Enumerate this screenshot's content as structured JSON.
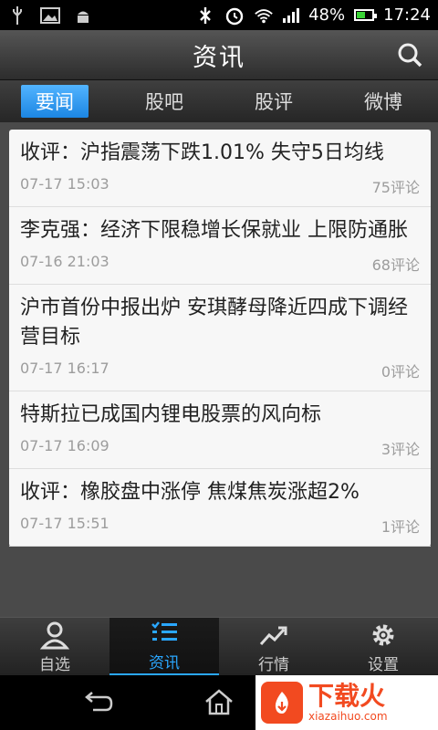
{
  "status": {
    "battery": "48%",
    "time": "17:24",
    "battery_level": 0.48,
    "left_icons": [
      "usb-icon",
      "image-icon",
      "android-icon"
    ],
    "right_icons": [
      "bluetooth-off-icon",
      "alarm-icon",
      "wifi-icon",
      "signal-icon",
      "battery-icon"
    ]
  },
  "header": {
    "title": "资讯",
    "search_icon": "search-icon"
  },
  "tabs": [
    {
      "label": "要闻",
      "active": true
    },
    {
      "label": "股吧",
      "active": false
    },
    {
      "label": "股评",
      "active": false
    },
    {
      "label": "微博",
      "active": false
    }
  ],
  "news": [
    {
      "headline": "收评：沪指震荡下跌1.01% 失守5日均线",
      "date": "07-17  15:03",
      "comments": "75评论"
    },
    {
      "headline": "李克强：经济下限稳增长保就业 上限防通胀",
      "date": "07-16  21:03",
      "comments": "68评论"
    },
    {
      "headline": "沪市首份中报出炉 安琪酵母降近四成下调经营目标",
      "date": "07-17  16:17",
      "comments": "0评论"
    },
    {
      "headline": "特斯拉已成国内锂电股票的风向标",
      "date": "07-17  16:09",
      "comments": "3评论"
    },
    {
      "headline": "收评：橡胶盘中涨停 焦煤焦炭涨超2%",
      "date": "07-17  15:51",
      "comments": "1评论"
    }
  ],
  "bottom_nav": [
    {
      "label": "自选",
      "icon": "user-icon",
      "active": false
    },
    {
      "label": "资讯",
      "icon": "list-icon",
      "active": true
    },
    {
      "label": "行情",
      "icon": "trend-chart-icon",
      "active": false
    },
    {
      "label": "设置",
      "icon": "gear-icon",
      "active": false
    }
  ],
  "system_nav": {
    "back_icon": "back-icon",
    "home_icon": "home-icon"
  },
  "watermark": {
    "brand": "下载火",
    "url": "xiazaihuo.com"
  },
  "colors": {
    "accent": "#2aa7ff",
    "tab_active": "#1c86e3",
    "battery_green": "#39d435",
    "watermark_red": "#f24a20"
  }
}
